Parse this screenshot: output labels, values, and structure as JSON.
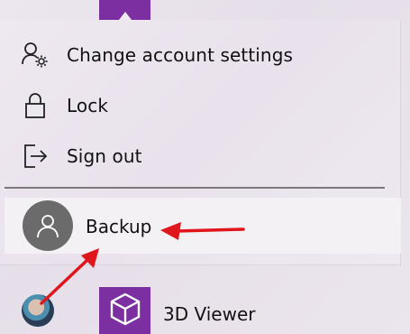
{
  "menu": {
    "items": [
      {
        "label": "Change account settings",
        "icon": "account-settings-icon"
      },
      {
        "label": "Lock",
        "icon": "lock-icon"
      },
      {
        "label": "Sign out",
        "icon": "sign-out-icon"
      }
    ],
    "other_account": {
      "label": "Backup",
      "icon": "user-avatar-icon"
    }
  },
  "apps": [
    {
      "label": "3D Viewer",
      "icon": "cube-icon"
    }
  ],
  "colors": {
    "tile_purple": "#7b2fa0",
    "annotation_red": "#e0161d",
    "avatar_gray": "#6b6b6b"
  }
}
